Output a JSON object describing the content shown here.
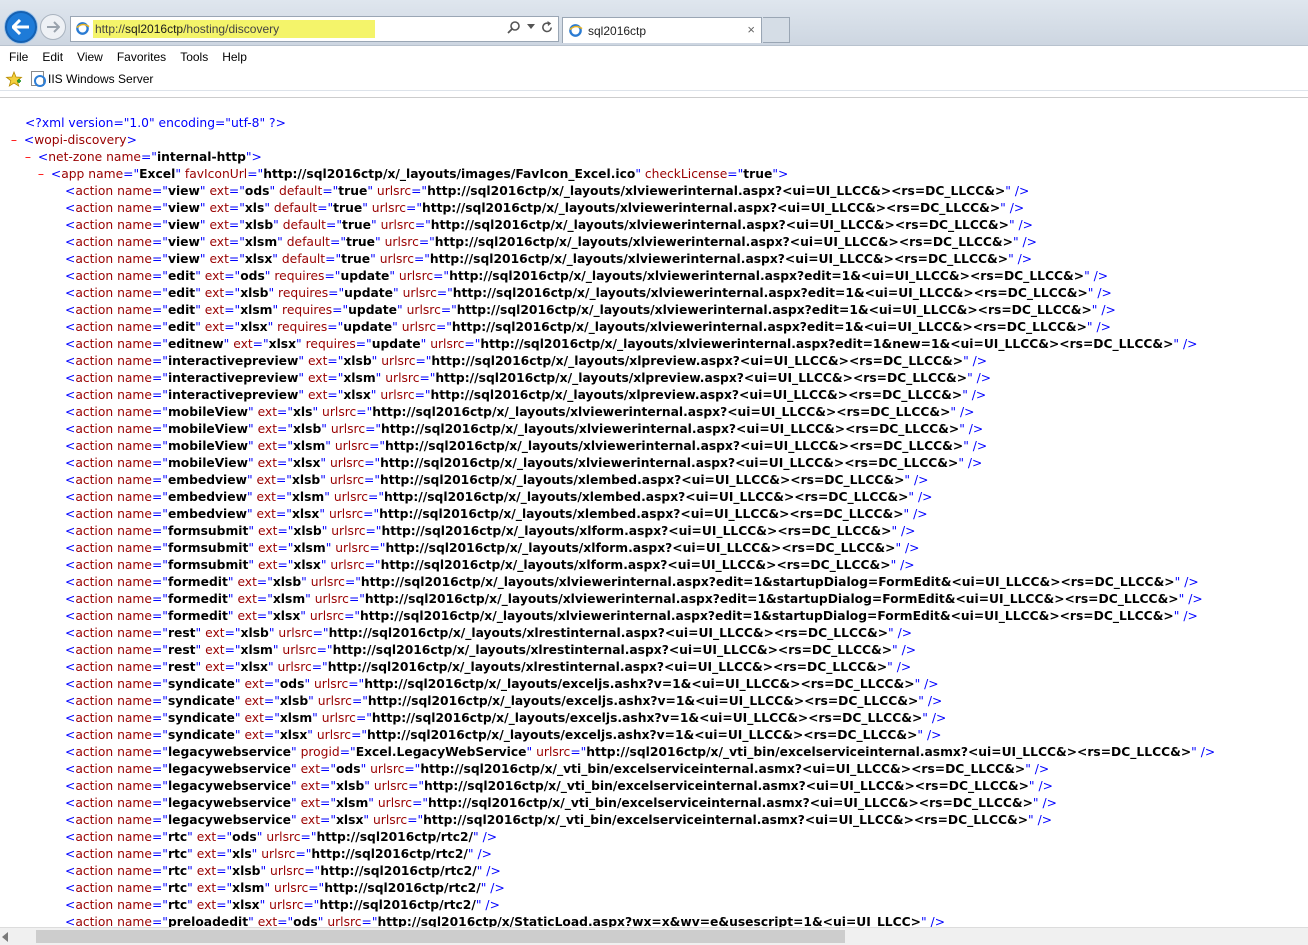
{
  "browser": {
    "url_scheme": "http://",
    "url_host": "sql2016ctp",
    "url_path": "/hosting/discovery",
    "tab_title": "sql2016ctp",
    "tab_close": "×"
  },
  "menu": [
    "File",
    "Edit",
    "View",
    "Favorites",
    "Tools",
    "Help"
  ],
  "favorites": {
    "item": "IIS Windows Server"
  },
  "xml": {
    "pi": "<?xml version=\"1.0\" encoding=\"utf-8\" ?>",
    "root_tag": "wopi-discovery",
    "netzone": {
      "tag": "net-zone",
      "name": "internal-http"
    },
    "app": {
      "tag": "app",
      "attrs": [
        [
          "name",
          "Excel"
        ],
        [
          "favIconUrl",
          "http://sql2016ctp/x/_layouts/images/FavIcon_Excel.ico"
        ],
        [
          "checkLicense",
          "true"
        ]
      ]
    },
    "actions": [
      [
        [
          "name",
          "view"
        ],
        [
          "ext",
          "ods"
        ],
        [
          "default",
          "true"
        ],
        [
          "urlsrc",
          "http://sql2016ctp/x/_layouts/xlviewerinternal.aspx?<ui=UI_LLCC&><rs=DC_LLCC&>"
        ]
      ],
      [
        [
          "name",
          "view"
        ],
        [
          "ext",
          "xls"
        ],
        [
          "default",
          "true"
        ],
        [
          "urlsrc",
          "http://sql2016ctp/x/_layouts/xlviewerinternal.aspx?<ui=UI_LLCC&><rs=DC_LLCC&>"
        ]
      ],
      [
        [
          "name",
          "view"
        ],
        [
          "ext",
          "xlsb"
        ],
        [
          "default",
          "true"
        ],
        [
          "urlsrc",
          "http://sql2016ctp/x/_layouts/xlviewerinternal.aspx?<ui=UI_LLCC&><rs=DC_LLCC&>"
        ]
      ],
      [
        [
          "name",
          "view"
        ],
        [
          "ext",
          "xlsm"
        ],
        [
          "default",
          "true"
        ],
        [
          "urlsrc",
          "http://sql2016ctp/x/_layouts/xlviewerinternal.aspx?<ui=UI_LLCC&><rs=DC_LLCC&>"
        ]
      ],
      [
        [
          "name",
          "view"
        ],
        [
          "ext",
          "xlsx"
        ],
        [
          "default",
          "true"
        ],
        [
          "urlsrc",
          "http://sql2016ctp/x/_layouts/xlviewerinternal.aspx?<ui=UI_LLCC&><rs=DC_LLCC&>"
        ]
      ],
      [
        [
          "name",
          "edit"
        ],
        [
          "ext",
          "ods"
        ],
        [
          "requires",
          "update"
        ],
        [
          "urlsrc",
          "http://sql2016ctp/x/_layouts/xlviewerinternal.aspx?edit=1&<ui=UI_LLCC&><rs=DC_LLCC&>"
        ]
      ],
      [
        [
          "name",
          "edit"
        ],
        [
          "ext",
          "xlsb"
        ],
        [
          "requires",
          "update"
        ],
        [
          "urlsrc",
          "http://sql2016ctp/x/_layouts/xlviewerinternal.aspx?edit=1&<ui=UI_LLCC&><rs=DC_LLCC&>"
        ]
      ],
      [
        [
          "name",
          "edit"
        ],
        [
          "ext",
          "xlsm"
        ],
        [
          "requires",
          "update"
        ],
        [
          "urlsrc",
          "http://sql2016ctp/x/_layouts/xlviewerinternal.aspx?edit=1&<ui=UI_LLCC&><rs=DC_LLCC&>"
        ]
      ],
      [
        [
          "name",
          "edit"
        ],
        [
          "ext",
          "xlsx"
        ],
        [
          "requires",
          "update"
        ],
        [
          "urlsrc",
          "http://sql2016ctp/x/_layouts/xlviewerinternal.aspx?edit=1&<ui=UI_LLCC&><rs=DC_LLCC&>"
        ]
      ],
      [
        [
          "name",
          "editnew"
        ],
        [
          "ext",
          "xlsx"
        ],
        [
          "requires",
          "update"
        ],
        [
          "urlsrc",
          "http://sql2016ctp/x/_layouts/xlviewerinternal.aspx?edit=1&new=1&<ui=UI_LLCC&><rs=DC_LLCC&>"
        ]
      ],
      [
        [
          "name",
          "interactivepreview"
        ],
        [
          "ext",
          "xlsb"
        ],
        [
          "urlsrc",
          "http://sql2016ctp/x/_layouts/xlpreview.aspx?<ui=UI_LLCC&><rs=DC_LLCC&>"
        ]
      ],
      [
        [
          "name",
          "interactivepreview"
        ],
        [
          "ext",
          "xlsm"
        ],
        [
          "urlsrc",
          "http://sql2016ctp/x/_layouts/xlpreview.aspx?<ui=UI_LLCC&><rs=DC_LLCC&>"
        ]
      ],
      [
        [
          "name",
          "interactivepreview"
        ],
        [
          "ext",
          "xlsx"
        ],
        [
          "urlsrc",
          "http://sql2016ctp/x/_layouts/xlpreview.aspx?<ui=UI_LLCC&><rs=DC_LLCC&>"
        ]
      ],
      [
        [
          "name",
          "mobileView"
        ],
        [
          "ext",
          "xls"
        ],
        [
          "urlsrc",
          "http://sql2016ctp/x/_layouts/xlviewerinternal.aspx?<ui=UI_LLCC&><rs=DC_LLCC&>"
        ]
      ],
      [
        [
          "name",
          "mobileView"
        ],
        [
          "ext",
          "xlsb"
        ],
        [
          "urlsrc",
          "http://sql2016ctp/x/_layouts/xlviewerinternal.aspx?<ui=UI_LLCC&><rs=DC_LLCC&>"
        ]
      ],
      [
        [
          "name",
          "mobileView"
        ],
        [
          "ext",
          "xlsm"
        ],
        [
          "urlsrc",
          "http://sql2016ctp/x/_layouts/xlviewerinternal.aspx?<ui=UI_LLCC&><rs=DC_LLCC&>"
        ]
      ],
      [
        [
          "name",
          "mobileView"
        ],
        [
          "ext",
          "xlsx"
        ],
        [
          "urlsrc",
          "http://sql2016ctp/x/_layouts/xlviewerinternal.aspx?<ui=UI_LLCC&><rs=DC_LLCC&>"
        ]
      ],
      [
        [
          "name",
          "embedview"
        ],
        [
          "ext",
          "xlsb"
        ],
        [
          "urlsrc",
          "http://sql2016ctp/x/_layouts/xlembed.aspx?<ui=UI_LLCC&><rs=DC_LLCC&>"
        ]
      ],
      [
        [
          "name",
          "embedview"
        ],
        [
          "ext",
          "xlsm"
        ],
        [
          "urlsrc",
          "http://sql2016ctp/x/_layouts/xlembed.aspx?<ui=UI_LLCC&><rs=DC_LLCC&>"
        ]
      ],
      [
        [
          "name",
          "embedview"
        ],
        [
          "ext",
          "xlsx"
        ],
        [
          "urlsrc",
          "http://sql2016ctp/x/_layouts/xlembed.aspx?<ui=UI_LLCC&><rs=DC_LLCC&>"
        ]
      ],
      [
        [
          "name",
          "formsubmit"
        ],
        [
          "ext",
          "xlsb"
        ],
        [
          "urlsrc",
          "http://sql2016ctp/x/_layouts/xlform.aspx?<ui=UI_LLCC&><rs=DC_LLCC&>"
        ]
      ],
      [
        [
          "name",
          "formsubmit"
        ],
        [
          "ext",
          "xlsm"
        ],
        [
          "urlsrc",
          "http://sql2016ctp/x/_layouts/xlform.aspx?<ui=UI_LLCC&><rs=DC_LLCC&>"
        ]
      ],
      [
        [
          "name",
          "formsubmit"
        ],
        [
          "ext",
          "xlsx"
        ],
        [
          "urlsrc",
          "http://sql2016ctp/x/_layouts/xlform.aspx?<ui=UI_LLCC&><rs=DC_LLCC&>"
        ]
      ],
      [
        [
          "name",
          "formedit"
        ],
        [
          "ext",
          "xlsb"
        ],
        [
          "urlsrc",
          "http://sql2016ctp/x/_layouts/xlviewerinternal.aspx?edit=1&startupDialog=FormEdit&<ui=UI_LLCC&><rs=DC_LLCC&>"
        ]
      ],
      [
        [
          "name",
          "formedit"
        ],
        [
          "ext",
          "xlsm"
        ],
        [
          "urlsrc",
          "http://sql2016ctp/x/_layouts/xlviewerinternal.aspx?edit=1&startupDialog=FormEdit&<ui=UI_LLCC&><rs=DC_LLCC&>"
        ]
      ],
      [
        [
          "name",
          "formedit"
        ],
        [
          "ext",
          "xlsx"
        ],
        [
          "urlsrc",
          "http://sql2016ctp/x/_layouts/xlviewerinternal.aspx?edit=1&startupDialog=FormEdit&<ui=UI_LLCC&><rs=DC_LLCC&>"
        ]
      ],
      [
        [
          "name",
          "rest"
        ],
        [
          "ext",
          "xlsb"
        ],
        [
          "urlsrc",
          "http://sql2016ctp/x/_layouts/xlrestinternal.aspx?<ui=UI_LLCC&><rs=DC_LLCC&>"
        ]
      ],
      [
        [
          "name",
          "rest"
        ],
        [
          "ext",
          "xlsm"
        ],
        [
          "urlsrc",
          "http://sql2016ctp/x/_layouts/xlrestinternal.aspx?<ui=UI_LLCC&><rs=DC_LLCC&>"
        ]
      ],
      [
        [
          "name",
          "rest"
        ],
        [
          "ext",
          "xlsx"
        ],
        [
          "urlsrc",
          "http://sql2016ctp/x/_layouts/xlrestinternal.aspx?<ui=UI_LLCC&><rs=DC_LLCC&>"
        ]
      ],
      [
        [
          "name",
          "syndicate"
        ],
        [
          "ext",
          "ods"
        ],
        [
          "urlsrc",
          "http://sql2016ctp/x/_layouts/exceljs.ashx?v=1&<ui=UI_LLCC&><rs=DC_LLCC&>"
        ]
      ],
      [
        [
          "name",
          "syndicate"
        ],
        [
          "ext",
          "xlsb"
        ],
        [
          "urlsrc",
          "http://sql2016ctp/x/_layouts/exceljs.ashx?v=1&<ui=UI_LLCC&><rs=DC_LLCC&>"
        ]
      ],
      [
        [
          "name",
          "syndicate"
        ],
        [
          "ext",
          "xlsm"
        ],
        [
          "urlsrc",
          "http://sql2016ctp/x/_layouts/exceljs.ashx?v=1&<ui=UI_LLCC&><rs=DC_LLCC&>"
        ]
      ],
      [
        [
          "name",
          "syndicate"
        ],
        [
          "ext",
          "xlsx"
        ],
        [
          "urlsrc",
          "http://sql2016ctp/x/_layouts/exceljs.ashx?v=1&<ui=UI_LLCC&><rs=DC_LLCC&>"
        ]
      ],
      [
        [
          "name",
          "legacywebservice"
        ],
        [
          "progid",
          "Excel.LegacyWebService"
        ],
        [
          "urlsrc",
          "http://sql2016ctp/x/_vti_bin/excelserviceinternal.asmx?<ui=UI_LLCC&><rs=DC_LLCC&>"
        ]
      ],
      [
        [
          "name",
          "legacywebservice"
        ],
        [
          "ext",
          "ods"
        ],
        [
          "urlsrc",
          "http://sql2016ctp/x/_vti_bin/excelserviceinternal.asmx?<ui=UI_LLCC&><rs=DC_LLCC&>"
        ]
      ],
      [
        [
          "name",
          "legacywebservice"
        ],
        [
          "ext",
          "xlsb"
        ],
        [
          "urlsrc",
          "http://sql2016ctp/x/_vti_bin/excelserviceinternal.asmx?<ui=UI_LLCC&><rs=DC_LLCC&>"
        ]
      ],
      [
        [
          "name",
          "legacywebservice"
        ],
        [
          "ext",
          "xlsm"
        ],
        [
          "urlsrc",
          "http://sql2016ctp/x/_vti_bin/excelserviceinternal.asmx?<ui=UI_LLCC&><rs=DC_LLCC&>"
        ]
      ],
      [
        [
          "name",
          "legacywebservice"
        ],
        [
          "ext",
          "xlsx"
        ],
        [
          "urlsrc",
          "http://sql2016ctp/x/_vti_bin/excelserviceinternal.asmx?<ui=UI_LLCC&><rs=DC_LLCC&>"
        ]
      ],
      [
        [
          "name",
          "rtc"
        ],
        [
          "ext",
          "ods"
        ],
        [
          "urlsrc",
          "http://sql2016ctp/rtc2/"
        ]
      ],
      [
        [
          "name",
          "rtc"
        ],
        [
          "ext",
          "xls"
        ],
        [
          "urlsrc",
          "http://sql2016ctp/rtc2/"
        ]
      ],
      [
        [
          "name",
          "rtc"
        ],
        [
          "ext",
          "xlsb"
        ],
        [
          "urlsrc",
          "http://sql2016ctp/rtc2/"
        ]
      ],
      [
        [
          "name",
          "rtc"
        ],
        [
          "ext",
          "xlsm"
        ],
        [
          "urlsrc",
          "http://sql2016ctp/rtc2/"
        ]
      ],
      [
        [
          "name",
          "rtc"
        ],
        [
          "ext",
          "xlsx"
        ],
        [
          "urlsrc",
          "http://sql2016ctp/rtc2/"
        ]
      ],
      [
        [
          "name",
          "preloadedit"
        ],
        [
          "ext",
          "ods"
        ],
        [
          "urlsrc",
          "http://sql2016ctp/x/StaticLoad.aspx?wx=x&wv=e&usescript=1&<ui=UI_LLCC>"
        ]
      ]
    ]
  }
}
